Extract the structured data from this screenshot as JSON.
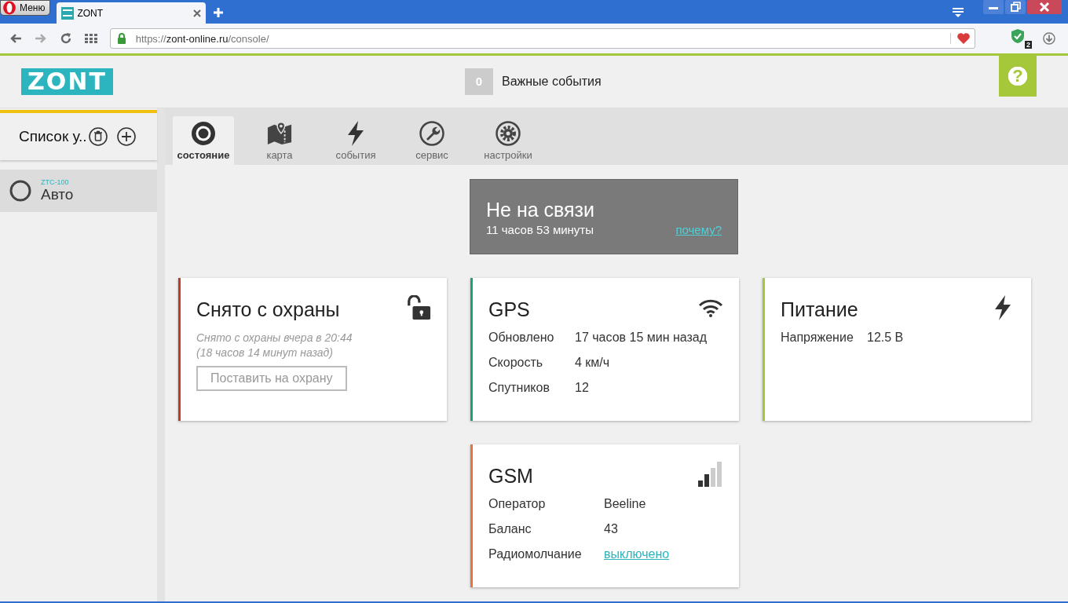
{
  "browser": {
    "menu_label": "Меню",
    "tab_title": "ZONT",
    "url_prefix": "https://",
    "url_host": "zont-online.ru",
    "url_path": "/console/",
    "adblock_count": "2"
  },
  "header": {
    "logo": "ZONT",
    "events_count": "0",
    "events_label": "Важные события",
    "help": "?"
  },
  "sidebar": {
    "title": "Список у..",
    "devices": [
      {
        "model": "ZTC-100",
        "name": "Авто",
        "selected": true
      }
    ]
  },
  "tabs": [
    {
      "label": "состояние",
      "selected": true
    },
    {
      "label": "карта",
      "selected": false
    },
    {
      "label": "события",
      "selected": false
    },
    {
      "label": "сервис",
      "selected": false
    },
    {
      "label": "настройки",
      "selected": false
    }
  ],
  "connection": {
    "title": "Не на связи",
    "duration": "11 часов 53 минуты",
    "link": "почему?"
  },
  "cards": [
    {
      "kind": "alarm",
      "color": "#c0392b",
      "title": "Снято с охраны",
      "note": "Снято с охраны вчера в 20:44",
      "note2": "(18 часов 14 минут назад)",
      "button": "Поставить на охрану"
    },
    {
      "kind": "info",
      "color": "#1aa37a",
      "title": "GPS",
      "rows": [
        {
          "label": "Обновлено",
          "value": "17 часов 15 мин назад"
        },
        {
          "label": "Скорость",
          "value": "4 км/ч"
        },
        {
          "label": "Спутников",
          "value": "12"
        }
      ]
    },
    {
      "kind": "info",
      "color": "#a5c83a",
      "title": "Питание",
      "rows": [
        {
          "label": "Напряжение",
          "value": "12.5 В"
        }
      ]
    },
    {
      "kind": "info",
      "color": "#e8743b",
      "title": "GSM",
      "rows": [
        {
          "label": "Оператор",
          "value": "Beeline"
        },
        {
          "label": "Баланс",
          "value": "43"
        },
        {
          "label": "Радиомолчание",
          "value": "выключено",
          "link": true
        }
      ]
    }
  ]
}
